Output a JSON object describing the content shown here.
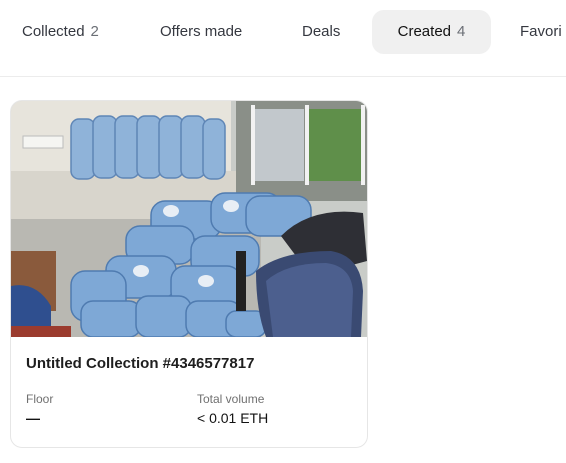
{
  "tabs": [
    {
      "label": "Collected",
      "count": "2"
    },
    {
      "label": "Offers made",
      "count": ""
    },
    {
      "label": "Deals",
      "count": ""
    },
    {
      "label": "Created",
      "count": "4"
    },
    {
      "label": "Favori",
      "count": ""
    }
  ],
  "card": {
    "title": "Untitled Collection #4346577817",
    "floor_label": "Floor",
    "floor_value": "—",
    "volume_label": "Total volume",
    "volume_value": "< 0.01 ETH"
  }
}
